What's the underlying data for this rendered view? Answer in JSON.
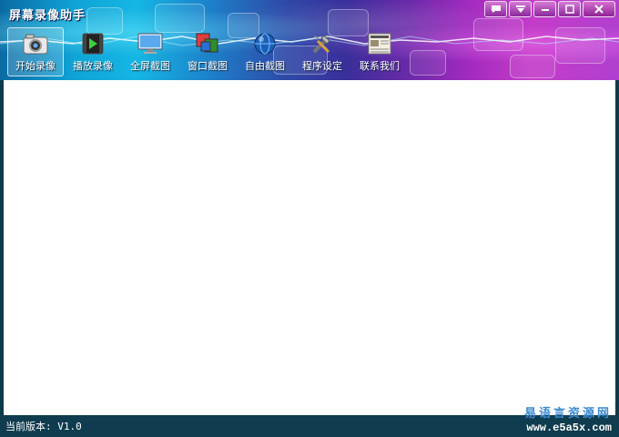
{
  "app": {
    "title": "屏幕录像助手"
  },
  "window_controls": [
    {
      "name": "chat-icon",
      "glyph": "▭"
    },
    {
      "name": "dropdown-icon",
      "glyph": "▼"
    },
    {
      "name": "minimize-icon",
      "glyph": "–"
    },
    {
      "name": "maximize-icon",
      "glyph": "□"
    },
    {
      "name": "close-icon",
      "glyph": "✕"
    }
  ],
  "toolbar": {
    "items": [
      {
        "label": "开始录像",
        "icon": "camera-icon",
        "active": true
      },
      {
        "label": "播放录像",
        "icon": "play-video-icon"
      },
      {
        "label": "全屏截图",
        "icon": "monitor-icon"
      },
      {
        "label": "窗口截图",
        "icon": "windows-icon"
      },
      {
        "label": "自由截图",
        "icon": "globe-icon"
      },
      {
        "label": "程序设定",
        "icon": "tools-icon"
      },
      {
        "label": "联系我们",
        "icon": "newspaper-icon"
      }
    ]
  },
  "status": {
    "version": "当前版本: V1.0"
  },
  "watermark": {
    "text": "易语言资源网",
    "url": "www.e5a5x.com"
  },
  "colors": {
    "status_bar": "#0f3c4e",
    "content_bg": "#ffffff",
    "title_text": "#ffffff"
  }
}
